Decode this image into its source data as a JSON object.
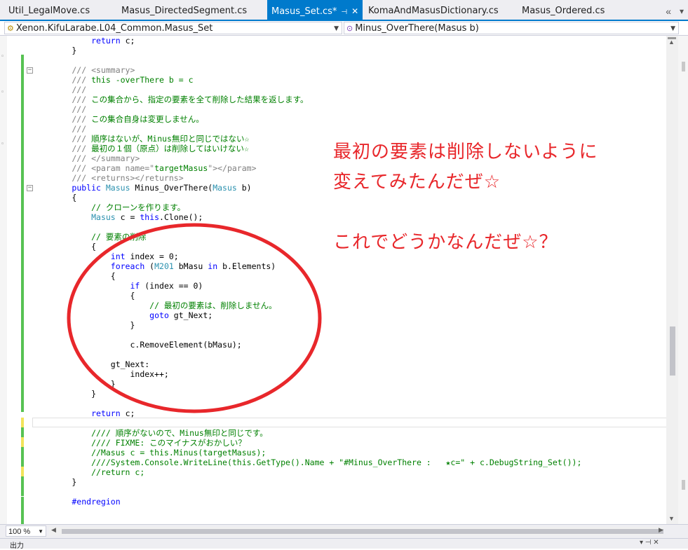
{
  "tabs": [
    {
      "label": "Util_LegalMove.cs",
      "active": false
    },
    {
      "label": "Masus_DirectedSegment.cs",
      "active": false
    },
    {
      "label": "Masus_Set.cs*",
      "active": true
    },
    {
      "label": "KomaAndMasusDictionary.cs",
      "active": false
    },
    {
      "label": "Masus_Ordered.cs",
      "active": false
    }
  ],
  "tab_overflow_icon": "«",
  "tab_menu_icon": "▾",
  "active_tab_pin": "⊣",
  "active_tab_close": "✕",
  "nav": {
    "scope": "Xenon.KifuLarabe.L04_Common.Masus_Set",
    "member": "Minus_OverThere(Masus b)",
    "scope_icon": "⚙",
    "member_icon": "⊙"
  },
  "code_lines": [
    [
      [
        "",
        "            "
      ],
      [
        "k",
        "return"
      ],
      [
        "",
        " c;"
      ]
    ],
    [
      [
        "",
        "        }"
      ]
    ],
    [
      [
        "",
        ""
      ]
    ],
    [
      [
        "d",
        "        /// <summary>"
      ]
    ],
    [
      [
        "d",
        "        ///"
      ],
      [
        "c",
        " this -overThere b = c"
      ]
    ],
    [
      [
        "d",
        "        ///"
      ]
    ],
    [
      [
        "d",
        "        ///"
      ],
      [
        "c",
        " この集合から、指定の要素を全て削除した結果を返します。"
      ]
    ],
    [
      [
        "d",
        "        ///"
      ]
    ],
    [
      [
        "d",
        "        ///"
      ],
      [
        "c",
        " この集合自身は変更しません。"
      ]
    ],
    [
      [
        "d",
        "        ///"
      ]
    ],
    [
      [
        "d",
        "        ///"
      ],
      [
        "c",
        " 順序はないが、Minus無印と同じではない☆"
      ]
    ],
    [
      [
        "d",
        "        ///"
      ],
      [
        "c",
        " 最初の１個（原点）は削除してはいけない☆"
      ]
    ],
    [
      [
        "d",
        "        /// </summary>"
      ]
    ],
    [
      [
        "d",
        "        /// <param name=\""
      ],
      [
        "c",
        "targetMasus"
      ],
      [
        "d",
        "\"></param>"
      ]
    ],
    [
      [
        "d",
        "        /// <returns></returns>"
      ]
    ],
    [
      [
        "",
        "        "
      ],
      [
        "k",
        "public"
      ],
      [
        "",
        " "
      ],
      [
        "t",
        "Masus"
      ],
      [
        "",
        " Minus_OverThere("
      ],
      [
        "t",
        "Masus"
      ],
      [
        "",
        " b)"
      ]
    ],
    [
      [
        "",
        "        {"
      ]
    ],
    [
      [
        "c",
        "            // クローンを作ります。"
      ]
    ],
    [
      [
        "",
        "            "
      ],
      [
        "t",
        "Masus"
      ],
      [
        "",
        " c = "
      ],
      [
        "k",
        "this"
      ],
      [
        "",
        ".Clone();"
      ]
    ],
    [
      [
        "",
        ""
      ]
    ],
    [
      [
        "c",
        "            // 要素の削除"
      ]
    ],
    [
      [
        "",
        "            {"
      ]
    ],
    [
      [
        "",
        "                "
      ],
      [
        "k",
        "int"
      ],
      [
        "",
        " index = 0;"
      ]
    ],
    [
      [
        "",
        "                "
      ],
      [
        "k",
        "foreach"
      ],
      [
        "",
        " ("
      ],
      [
        "t",
        "M201"
      ],
      [
        "",
        " bMasu "
      ],
      [
        "k",
        "in"
      ],
      [
        "",
        " b.Elements)"
      ]
    ],
    [
      [
        "",
        "                {"
      ]
    ],
    [
      [
        "",
        "                    "
      ],
      [
        "k",
        "if"
      ],
      [
        "",
        " (index == 0)"
      ]
    ],
    [
      [
        "",
        "                    {"
      ]
    ],
    [
      [
        "c",
        "                        // 最初の要素は、削除しません。"
      ]
    ],
    [
      [
        "",
        "                        "
      ],
      [
        "k",
        "goto"
      ],
      [
        "",
        " gt_Next;"
      ]
    ],
    [
      [
        "",
        "                    }"
      ]
    ],
    [
      [
        "",
        ""
      ]
    ],
    [
      [
        "",
        "                    c.RemoveElement(bMasu);"
      ]
    ],
    [
      [
        "",
        ""
      ]
    ],
    [
      [
        "",
        "                gt_Next:"
      ]
    ],
    [
      [
        "",
        "                    index++;"
      ]
    ],
    [
      [
        "",
        "                }"
      ]
    ],
    [
      [
        "",
        "            }"
      ]
    ],
    [
      [
        "",
        ""
      ]
    ],
    [
      [
        "",
        "            "
      ],
      [
        "k",
        "return"
      ],
      [
        "",
        " c;"
      ]
    ],
    [
      [
        "",
        ""
      ]
    ],
    [
      [
        "c",
        "            //// 順序がないので、Minus無印と同じです。"
      ]
    ],
    [
      [
        "c",
        "            //// FIXME: このマイナスがおかしい？"
      ]
    ],
    [
      [
        "c",
        "            //Masus c = this.Minus(targetMasus);"
      ]
    ],
    [
      [
        "c",
        "            ////System.Console.WriteLine(this.GetType().Name + \"#Minus_OverThere :   ★c=\" + c.DebugString_Set());"
      ]
    ],
    [
      [
        "c",
        "            //return c;"
      ]
    ],
    [
      [
        "",
        "        }"
      ]
    ],
    [
      [
        "",
        ""
      ]
    ],
    [
      [
        "p",
        "        #endregion"
      ]
    ]
  ],
  "annotation": {
    "line1": "最初の要素は削除しないように",
    "line2": "変えてみたんだぜ☆",
    "line3": "これでどうかなんだぜ☆？",
    "color": "#e8272b"
  },
  "zoom": {
    "value": "100 %"
  },
  "output_panel": {
    "label": "出力",
    "controls": "▾ ⊣ ✕"
  },
  "colors": {
    "accent": "#007acc",
    "keyword": "#0000ff",
    "comment": "#008000",
    "type": "#2b91af",
    "change_green": "#57c253",
    "change_yellow": "#f2e35a"
  }
}
